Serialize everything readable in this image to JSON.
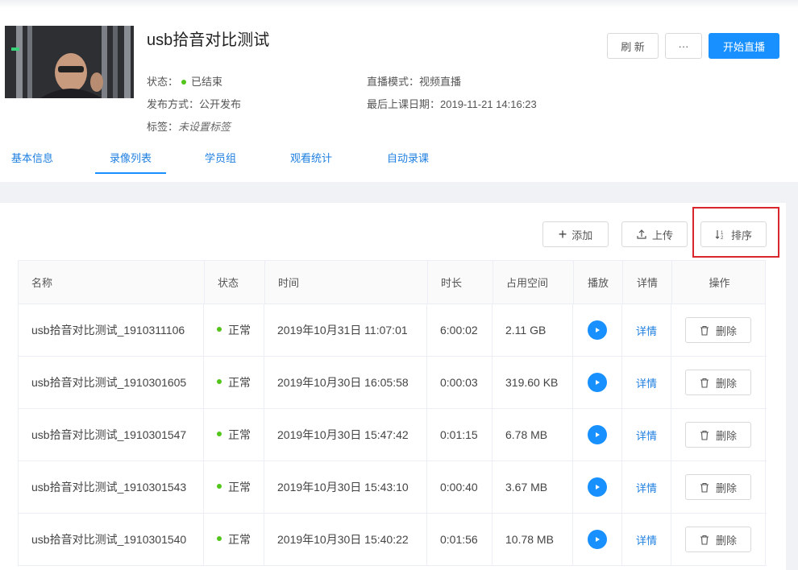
{
  "header": {
    "title": "usb拾音对比测试",
    "status_label": "状态：",
    "status_value": "已结束",
    "publish_label": "发布方式：",
    "publish_value": "公开发布",
    "tags_label": "标签：",
    "tags_value": "未设置标签",
    "mode_label": "直播模式：",
    "mode_value": "视频直播",
    "last_date_label": "最后上课日期：",
    "last_date_value": "2019-11-21 14:16:23",
    "refresh_label": "刷 新",
    "more_label": "···",
    "start_label": "开始直播"
  },
  "tabs": [
    "基本信息",
    "录像列表",
    "学员组",
    "观看统计",
    "自动录课"
  ],
  "toolbar": {
    "add_label": "添加",
    "upload_label": "上传",
    "sort_label": "排序"
  },
  "table": {
    "columns": [
      "名称",
      "状态",
      "时间",
      "时长",
      "占用空间",
      "播放",
      "详情",
      "操作"
    ],
    "rows": [
      {
        "name": "usb拾音对比测试_1910311106",
        "status": "正常",
        "time": "2019年10月31日 11:07:01",
        "duration": "6:00:02",
        "size": "2.11 GB",
        "detail": "详情",
        "delete": "删除"
      },
      {
        "name": "usb拾音对比测试_1910301605",
        "status": "正常",
        "time": "2019年10月30日 16:05:58",
        "duration": "0:00:03",
        "size": "319.60 KB",
        "detail": "详情",
        "delete": "删除"
      },
      {
        "name": "usb拾音对比测试_1910301547",
        "status": "正常",
        "time": "2019年10月30日 15:47:42",
        "duration": "0:01:15",
        "size": "6.78 MB",
        "detail": "详情",
        "delete": "删除"
      },
      {
        "name": "usb拾音对比测试_1910301543",
        "status": "正常",
        "time": "2019年10月30日 15:43:10",
        "duration": "0:00:40",
        "size": "3.67 MB",
        "detail": "详情",
        "delete": "删除"
      },
      {
        "name": "usb拾音对比测试_1910301540",
        "status": "正常",
        "time": "2019年10月30日 15:40:22",
        "duration": "0:01:56",
        "size": "10.78 MB",
        "detail": "详情",
        "delete": "删除"
      }
    ]
  },
  "colors": {
    "accent": "#1890ff",
    "status_ok": "#52c41a",
    "highlight": "#d9252c"
  }
}
